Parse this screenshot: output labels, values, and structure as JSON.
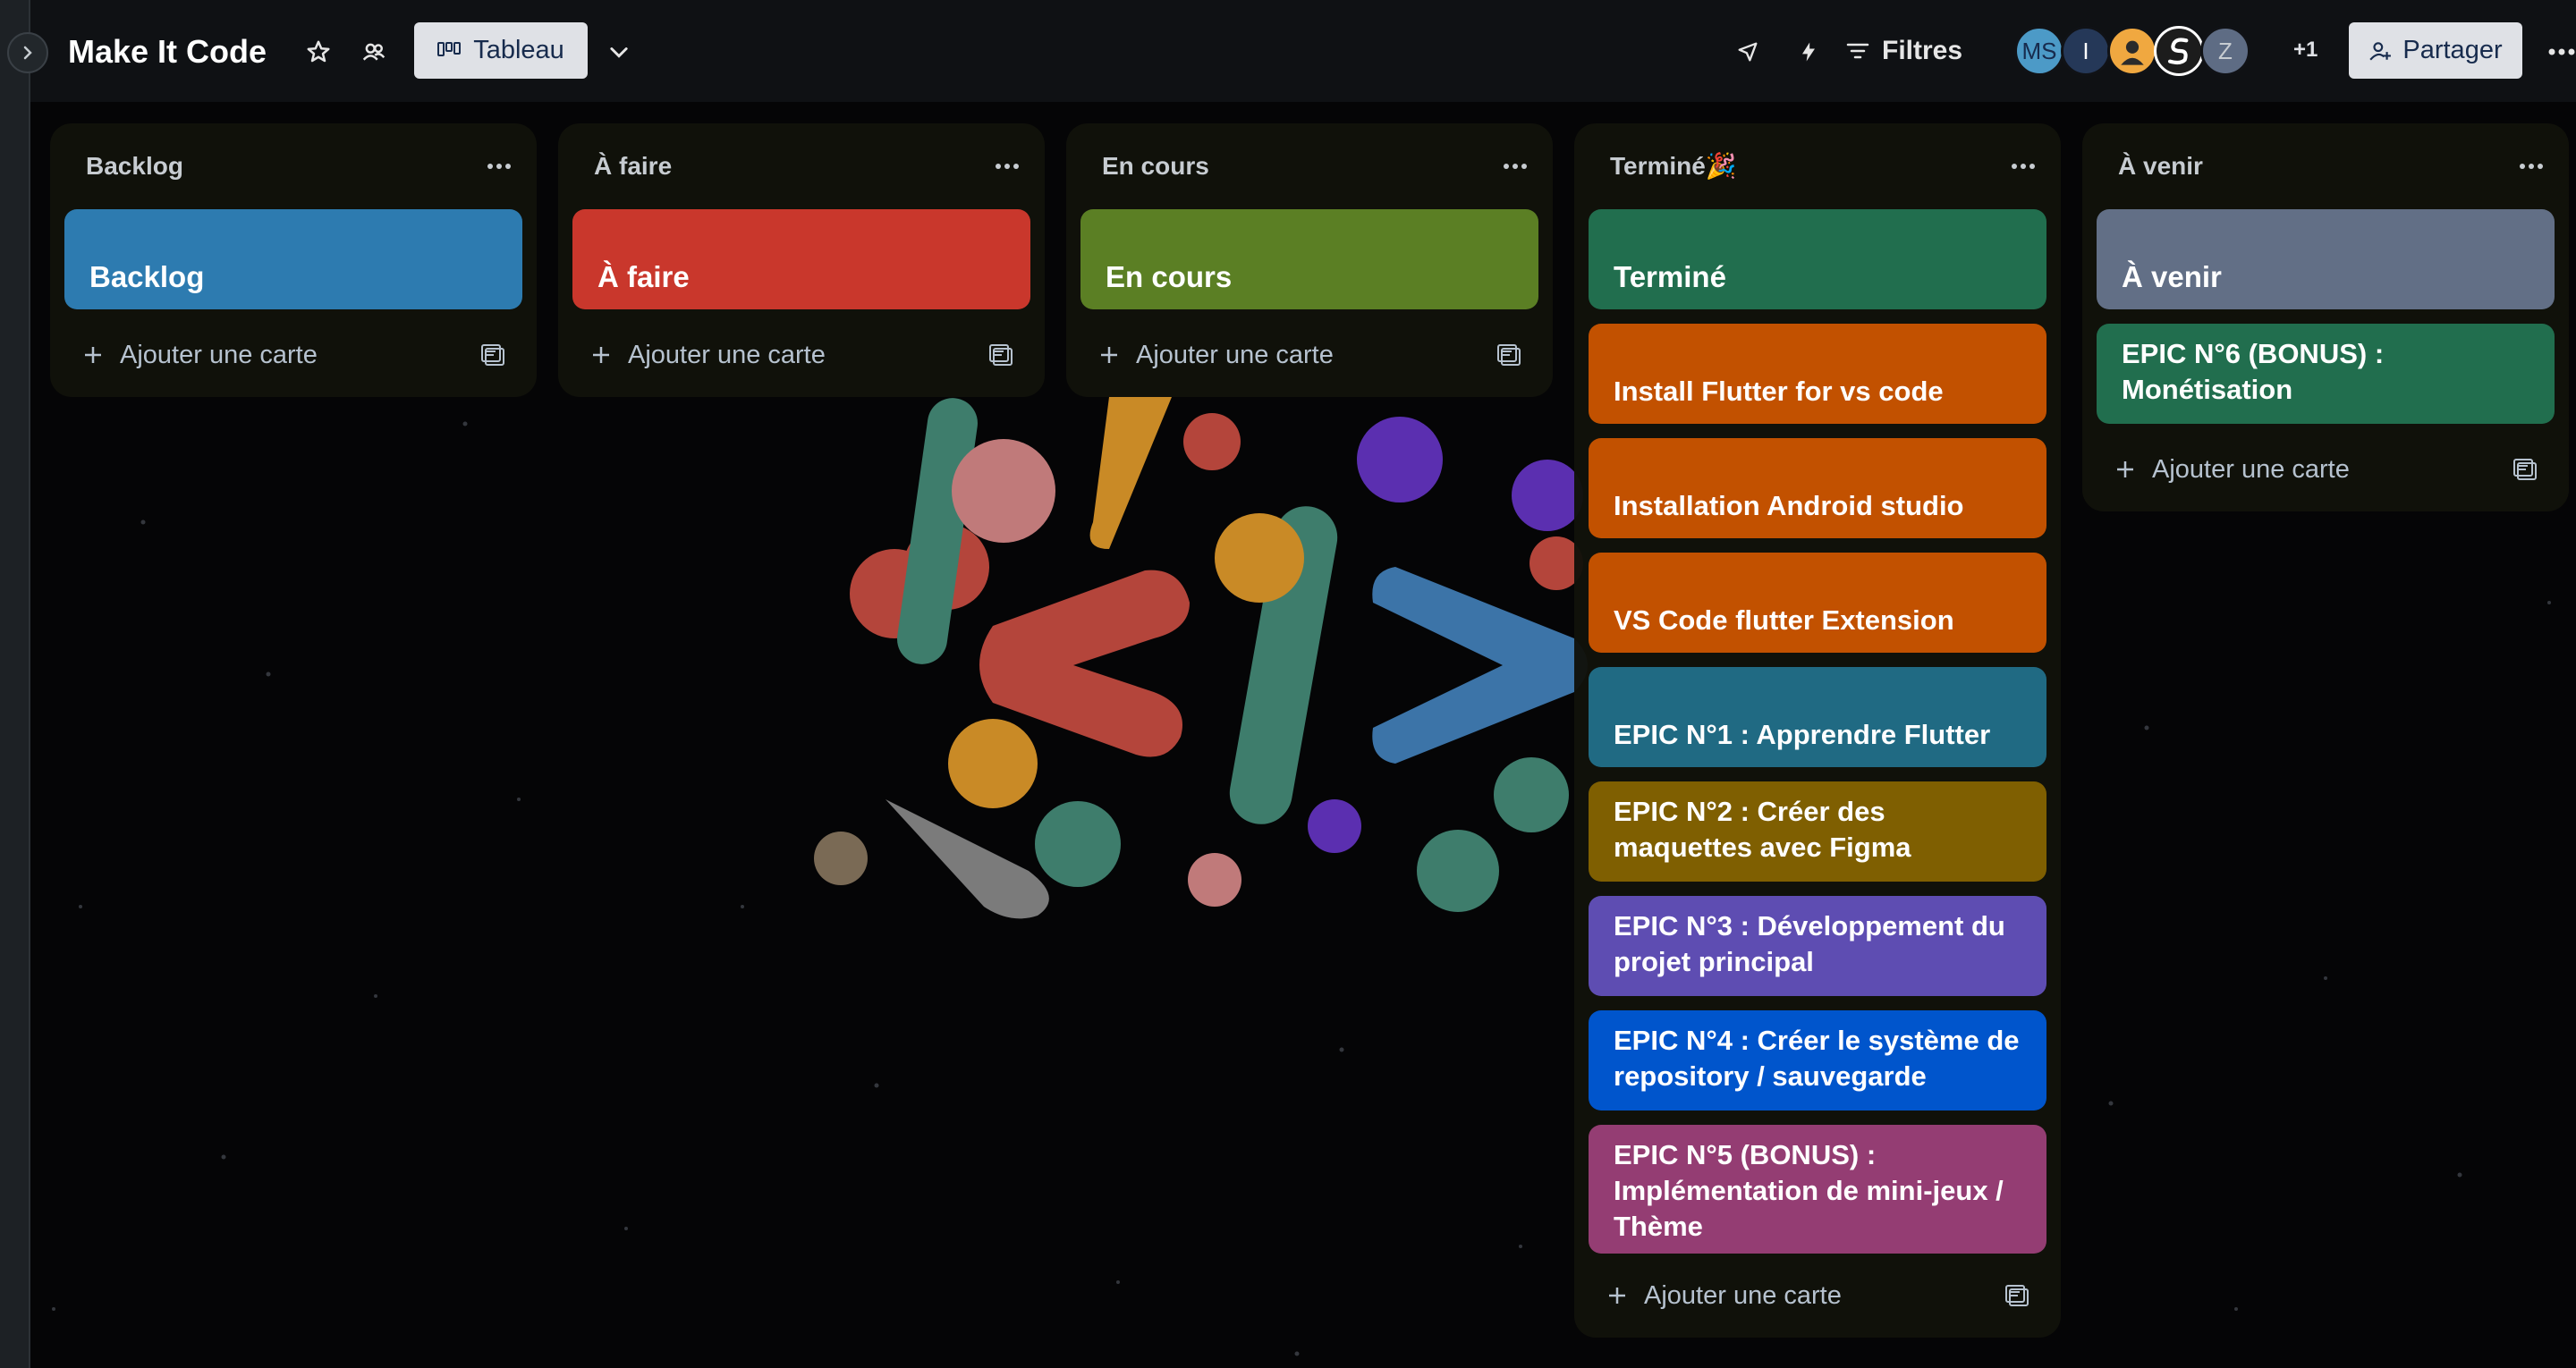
{
  "header": {
    "title": "Make It Code",
    "view_label": "Tableau",
    "filters_label": "Filtres",
    "share_label": "Partager",
    "extra_members": "+1",
    "avatars": [
      {
        "initials": "MS",
        "color": "#4c9ac7"
      },
      {
        "initials": "I",
        "color": "#253858"
      },
      {
        "initials": "",
        "color": "#f0a840"
      },
      {
        "initials": "",
        "color": "#ffffff"
      },
      {
        "initials": "Z",
        "color": "#5e6c84"
      }
    ]
  },
  "lists": [
    {
      "title": "Backlog",
      "cards": [
        {
          "text": "Backlog",
          "color": "#2d7bb0"
        }
      ],
      "add_label": "Ajouter une carte"
    },
    {
      "title": "À faire",
      "cards": [
        {
          "text": "À faire",
          "color": "#c9372c"
        }
      ],
      "add_label": "Ajouter une carte"
    },
    {
      "title": "En cours",
      "cards": [
        {
          "text": "En cours",
          "color": "#5b7f24"
        }
      ],
      "add_label": "Ajouter une carte"
    },
    {
      "title": "Terminé🎉",
      "cards": [
        {
          "text": "Terminé",
          "color": "#216e4e"
        },
        {
          "text": "Install Flutter for vs code",
          "color": "#c25100"
        },
        {
          "text": "Installation Android studio",
          "color": "#c25100"
        },
        {
          "text": "VS Code flutter Extension",
          "color": "#c25100"
        },
        {
          "text": "EPIC N°1 : Apprendre Flutter",
          "color": "#206a83"
        },
        {
          "text": "EPIC N°2 : Créer des maquettes avec Figma",
          "color": "#7f5f01"
        },
        {
          "text": "EPIC N°3 : Développement du projet principal",
          "color": "#5e4db2"
        },
        {
          "text": "EPIC N°4 : Créer le système de repository / sauvegarde",
          "color": "#0055cc"
        },
        {
          "text": "EPIC N°5 (BONUS) : Implémentation de mini-jeux / Thème",
          "color": "#943d73"
        }
      ],
      "add_label": "Ajouter une carte"
    },
    {
      "title": "À venir",
      "cards": [
        {
          "text": "À venir",
          "color": "#626f86"
        },
        {
          "text": "EPIC N°6 (BONUS) : Monétisation",
          "color": "#216e4e"
        }
      ],
      "add_label": "Ajouter une carte"
    }
  ]
}
